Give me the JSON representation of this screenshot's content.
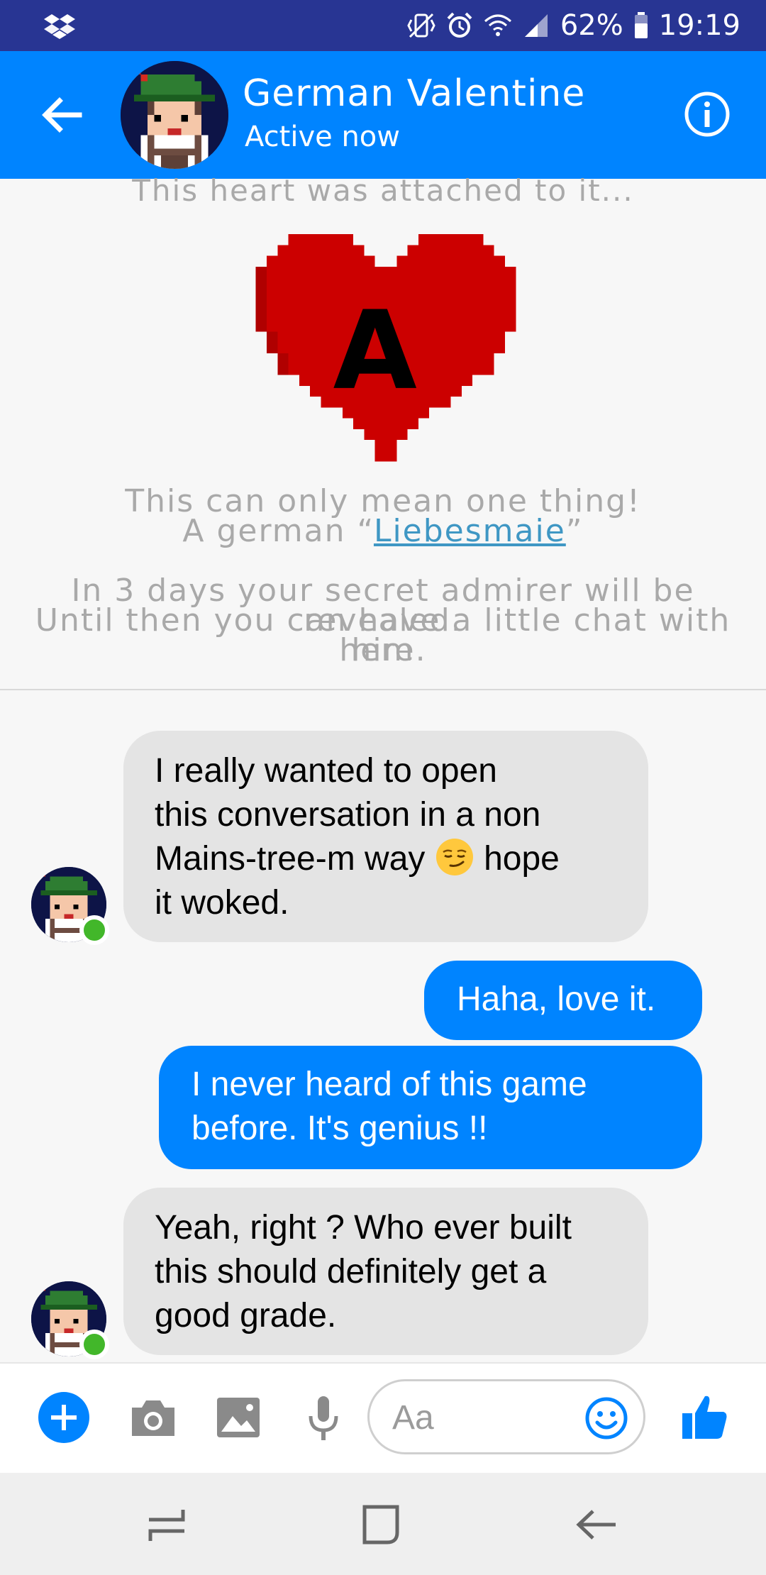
{
  "status_bar": {
    "battery": "62%",
    "time": "19:19",
    "icons": [
      "dropbox-icon",
      "vibrate-icon",
      "alarm-icon",
      "wifi-icon",
      "signal-icon",
      "battery-icon"
    ]
  },
  "header": {
    "name": "German Valentine",
    "status": "Active now",
    "icons": [
      "back-arrow-icon",
      "info-icon"
    ]
  },
  "intro": {
    "attached": "This heart was attached to it...",
    "heart_letter": "A",
    "line1": "This can only mean one thing!",
    "line2_prefix": "A german “",
    "line2_link": "Liebesmaie",
    "line2_suffix": "”",
    "para_line1": "In 3 days your secret admirer will be revealed.",
    "para_line2": "Until then you can have a little chat with him",
    "para_line3": "here."
  },
  "messages": [
    {
      "from": "them",
      "lines": [
        "I really wanted to open",
        "this conversation in a non",
        "Mains-tree-m way",
        " hope",
        "it woked."
      ],
      "emoji": "smirking-face"
    },
    {
      "from": "me",
      "text": "Haha, love it."
    },
    {
      "from": "me",
      "lines": [
        "I never heard of this game",
        "before. It's genius !!"
      ]
    },
    {
      "from": "them",
      "lines": [
        "Yeah, right ? Who ever built",
        "this should definitely get a",
        "good grade."
      ]
    }
  ],
  "composer": {
    "placeholder": "Aa",
    "icons": [
      "plus-icon",
      "camera-icon",
      "image-icon",
      "microphone-icon",
      "emoji-icon",
      "thumbs-up-icon"
    ]
  },
  "nav": {
    "icons": [
      "recent-apps-icon",
      "home-icon",
      "back-icon"
    ]
  },
  "colors": {
    "status_bar": "#283593",
    "header": "#0084ff",
    "outgoing_bubble": "#0084ff",
    "incoming_bubble": "#e4e4e4",
    "heart": "#cc0000",
    "link": "#3f97c4",
    "online": "#42b72a"
  }
}
